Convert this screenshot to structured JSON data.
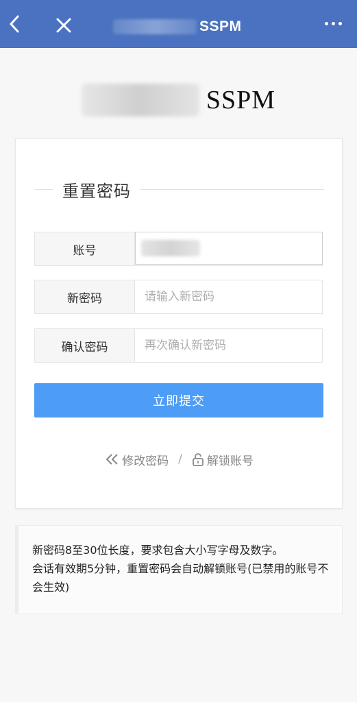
{
  "topbar": {
    "title": "SSPM",
    "back_icon": "chevron-left-icon",
    "close_icon": "close-icon",
    "more_icon": "more-horizontal-icon",
    "background": "#4a72c0"
  },
  "brand": {
    "text": "SSPM"
  },
  "form": {
    "heading": "重置密码",
    "account": {
      "label": "账号",
      "value": ""
    },
    "new_password": {
      "label": "新密码",
      "placeholder": "请输入新密码"
    },
    "confirm_password": {
      "label": "确认密码",
      "placeholder": "再次确认新密码"
    },
    "submit_label": "立即提交",
    "submit_color": "#4d9cf5"
  },
  "links": {
    "change_password": "修改密码",
    "separator": "/",
    "unlock_account": "解锁账号"
  },
  "note": {
    "line1": "新密码8至30位长度，要求包含大小写字母及数字。",
    "line2": "会话有效期5分钟，重置密码会自动解锁账号(已禁用的账号不会生效)"
  }
}
